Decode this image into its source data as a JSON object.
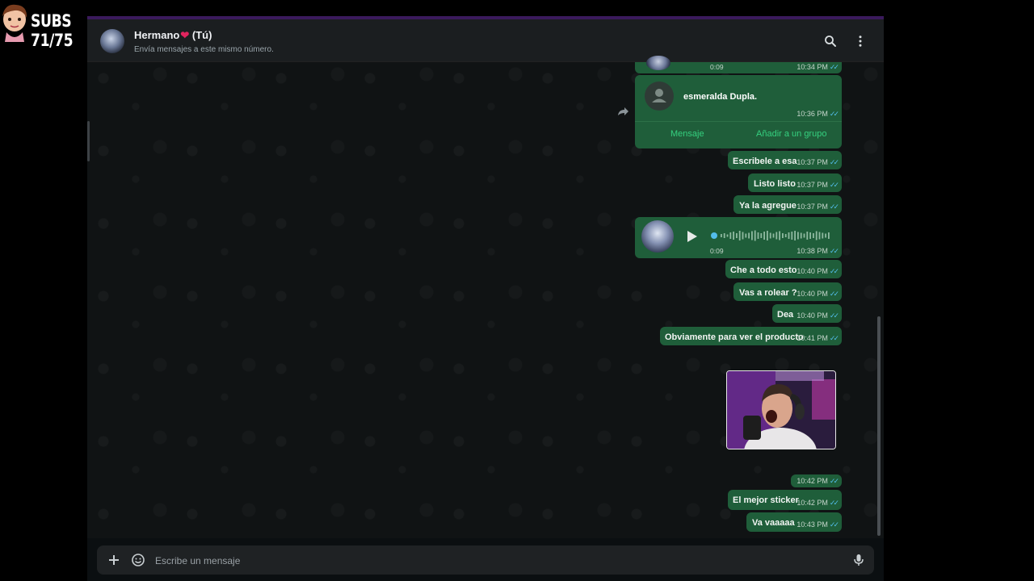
{
  "overlay": {
    "subs_text": "SUBS 71/75"
  },
  "header": {
    "contact_name": "Hermano",
    "heart": "❤",
    "self_tag": "(Tú)",
    "subtitle": "Envía mensajes a este mismo número."
  },
  "messages": {
    "top_voice": {
      "duration": "0:09",
      "time": "10:34 PM"
    },
    "contact_card": {
      "name": "esmeralda Dupla.",
      "time": "10:36 PM",
      "action_message": "Mensaje",
      "action_group": "Añadir a un grupo"
    },
    "m1": {
      "text": "Escribele a esa",
      "time": "10:37 PM"
    },
    "m2": {
      "text": "Listo listo",
      "time": "10:37 PM"
    },
    "m3": {
      "text": "Ya la agregue",
      "time": "10:37 PM"
    },
    "voice": {
      "duration": "0:09",
      "time": "10:38 PM"
    },
    "m4": {
      "text": "Che a todo esto",
      "time": "10:40 PM"
    },
    "m5": {
      "text": "Vas a rolear ?",
      "time": "10:40 PM"
    },
    "m6": {
      "text": "Dea",
      "time": "10:40 PM"
    },
    "m7": {
      "text": "Obviamente para ver el producto",
      "time": "10:41 PM"
    },
    "sticker": {
      "time": "10:42 PM"
    },
    "m8": {
      "text": "El mejor sticker",
      "time": "10:42 PM"
    },
    "m9": {
      "text": "Va vaaaaa",
      "time": "10:43 PM"
    }
  },
  "composer": {
    "placeholder": "Escribe un mensaje"
  },
  "icons": {
    "search": "search-icon",
    "menu": "menu-icon",
    "forward": "forward-icon",
    "plus": "plus-icon",
    "emoji": "emoji-icon",
    "mic": "mic-icon",
    "play": "play-icon"
  },
  "colors": {
    "bubble": "#1f5e3a",
    "accent": "#35d07f",
    "tick": "#53bdeb",
    "header": "#1b1e20"
  }
}
